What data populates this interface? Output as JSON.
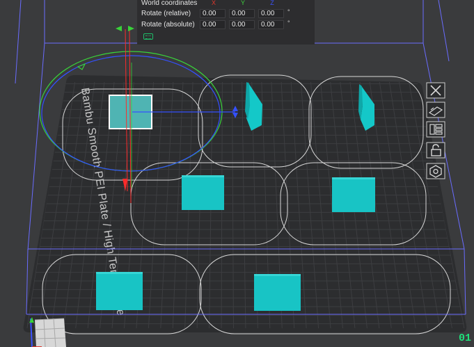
{
  "rotate_panel": {
    "world_coordinates_label": "World coordinates",
    "axis_labels": {
      "x": "X",
      "y": "Y",
      "z": "Z"
    },
    "axis_colors": {
      "x": "#e0362b",
      "y": "#3ed23e",
      "z": "#3a52ff"
    },
    "rotate_relative": {
      "label": "Rotate (relative)",
      "x": "0.00",
      "y": "0.00",
      "z": "0.00",
      "unit": "°"
    },
    "rotate_absolute": {
      "label": "Rotate (absolute)",
      "x": "0.00",
      "y": "0.00",
      "z": "0.00",
      "unit": "°"
    }
  },
  "plate": {
    "name_label": "Bambu Smooth PEI Plate / High Temp Plate",
    "colors": {
      "plate": "#2c2d2f",
      "grid": "#3d3e41",
      "object": "#18bfc0",
      "selected_object": "#4fb4b3",
      "bounding_box": "#6a6cff"
    }
  },
  "right_toolbar": {
    "icons": [
      "close-icon",
      "auto-orient-icon",
      "arrange-icon",
      "lock-icon",
      "settings-icon"
    ]
  },
  "corner_indicator": "01"
}
